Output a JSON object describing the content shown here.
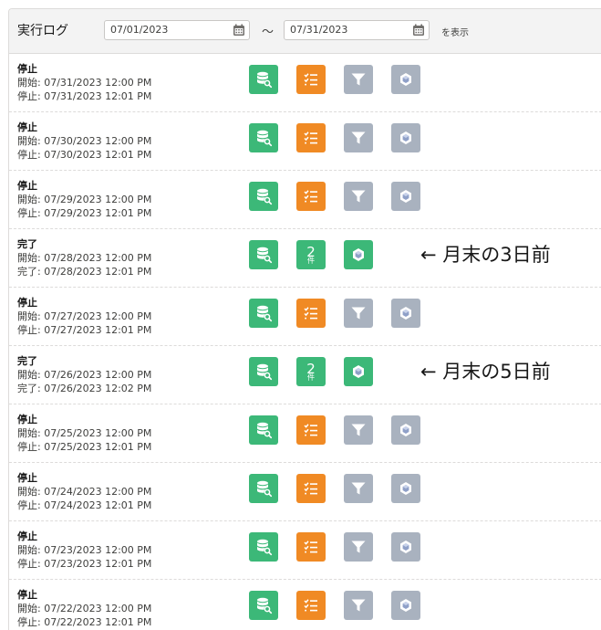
{
  "header": {
    "title": "実行ログ",
    "date_from": "07/01/2023",
    "date_to": "07/31/2023",
    "separator": "～",
    "show_label": "を表示"
  },
  "colors": {
    "green": "#3cb878",
    "orange": "#f08a24",
    "grey": "#a9b2bf"
  },
  "rows": [
    {
      "status": "停止",
      "start": "開始: 07/31/2023 12:00 PM",
      "end": "停止: 07/31/2023 12:01 PM",
      "result": "stopped"
    },
    {
      "status": "停止",
      "start": "開始: 07/30/2023 12:00 PM",
      "end": "停止: 07/30/2023 12:01 PM",
      "result": "stopped"
    },
    {
      "status": "停止",
      "start": "開始: 07/29/2023 12:00 PM",
      "end": "停止: 07/29/2023 12:01 PM",
      "result": "stopped"
    },
    {
      "status": "完了",
      "start": "開始: 07/28/2023 12:00 PM",
      "end": "完了: 07/28/2023 12:01 PM",
      "result": "completed",
      "count": "2",
      "count_unit": "件",
      "note": "← 月末の3日前"
    },
    {
      "status": "停止",
      "start": "開始: 07/27/2023 12:00 PM",
      "end": "停止: 07/27/2023 12:01 PM",
      "result": "stopped"
    },
    {
      "status": "完了",
      "start": "開始: 07/26/2023 12:00 PM",
      "end": "完了: 07/26/2023 12:02 PM",
      "result": "completed",
      "count": "2",
      "count_unit": "件",
      "note": "← 月末の5日前"
    },
    {
      "status": "停止",
      "start": "開始: 07/25/2023 12:00 PM",
      "end": "停止: 07/25/2023 12:01 PM",
      "result": "stopped"
    },
    {
      "status": "停止",
      "start": "開始: 07/24/2023 12:00 PM",
      "end": "停止: 07/24/2023 12:01 PM",
      "result": "stopped"
    },
    {
      "status": "停止",
      "start": "開始: 07/23/2023 12:00 PM",
      "end": "停止: 07/23/2023 12:01 PM",
      "result": "stopped"
    },
    {
      "status": "停止",
      "start": "開始: 07/22/2023 12:00 PM",
      "end": "停止: 07/22/2023 12:01 PM",
      "result": "stopped"
    }
  ]
}
